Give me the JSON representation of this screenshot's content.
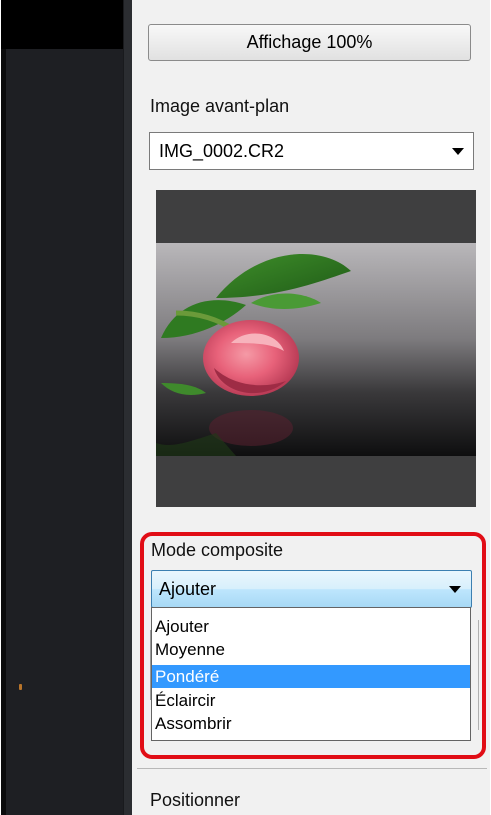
{
  "panel": {
    "view_button_label": "Affichage 100%",
    "foreground_label": "Image avant-plan",
    "foreground_file": "IMG_0002.CR2",
    "composite_label": "Mode composite",
    "composite_selected": "Ajouter",
    "composite_options": [
      "Ajouter",
      "Moyenne",
      "Pondéré",
      "Éclaircir",
      "Assombrir"
    ],
    "composite_highlighted_index": 2,
    "position_label": "Positionner"
  },
  "icons": {
    "dropdown_arrow": "chevron-down-icon",
    "preview": "rose-photo-thumbnail"
  },
  "colors": {
    "highlight_border": "#e10d16",
    "selection": "#3399ff",
    "dark_canvas": "#1e1f23"
  }
}
